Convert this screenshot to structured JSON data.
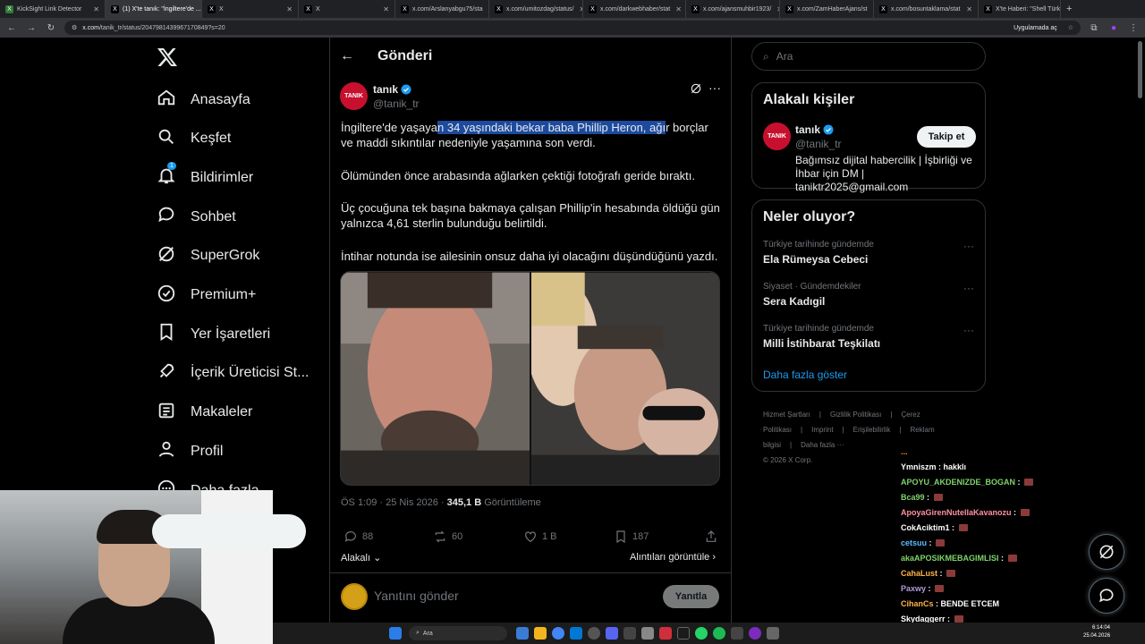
{
  "browser": {
    "tabs": [
      {
        "title": "KickSight Link Detector",
        "active": false,
        "color": "#2e7d32"
      },
      {
        "title": "(1) X'te tanık: \"İngiltere'de ...",
        "active": true,
        "color": "#000000"
      },
      {
        "title": "X",
        "active": false,
        "color": "#000000"
      },
      {
        "title": "X",
        "active": false,
        "color": "#000000"
      },
      {
        "title": "x.com/Arslanyabgu75/sta",
        "active": false,
        "color": "#000000"
      },
      {
        "title": "x.com/umitozdag/status/",
        "active": false,
        "color": "#000000"
      },
      {
        "title": "x.com/darkwebhaber/stat",
        "active": false,
        "color": "#000000"
      },
      {
        "title": "x.com/ajansmuhbir1923/",
        "active": false,
        "color": "#000000"
      },
      {
        "title": "x.com/ZamHaberAjans/st",
        "active": false,
        "color": "#000000"
      },
      {
        "title": "x.com/bosuntaklama/stat",
        "active": false,
        "color": "#000000"
      },
      {
        "title": "X'te Haberi: \"Shell Türkiye",
        "active": false,
        "color": "#000000"
      }
    ],
    "url_host": "x.com",
    "url_path": "/tanik_tr/status/2047981439967170849?s=20",
    "install_label": "Uygulamada aç"
  },
  "sidebar": {
    "items": [
      {
        "label": "Anasayfa",
        "icon": "home-icon"
      },
      {
        "label": "Keşfet",
        "icon": "search-icon"
      },
      {
        "label": "Bildirimler",
        "icon": "bell-icon",
        "badge": "1"
      },
      {
        "label": "Sohbet",
        "icon": "chat-icon"
      },
      {
        "label": "SuperGrok",
        "icon": "grok-icon"
      },
      {
        "label": "Premium+",
        "icon": "verified-icon"
      },
      {
        "label": "Yer İşaretleri",
        "icon": "bookmark-icon"
      },
      {
        "label": "İçerik Üreticisi St...",
        "icon": "rocket-icon"
      },
      {
        "label": "Makaleler",
        "icon": "article-icon"
      },
      {
        "label": "Profil",
        "icon": "person-icon"
      },
      {
        "label": "Daha fazla",
        "icon": "more-icon"
      }
    ]
  },
  "post": {
    "header_title": "Gönderi",
    "author_name": "tanık",
    "author_handle": "@tanik_tr",
    "avatar_text": "TANIK",
    "para1_pre": "İngiltere'de yaşaya",
    "para1_hl": "n 34 yaşındaki bekar baba Phillip Heron, ağı",
    "para1_post": "r borçlar ve maddi sıkıntılar nedeniyle yaşamına son verdi.",
    "para2": "Ölümünden önce arabasında ağlarken çektiği fotoğrafı geride bıraktı.",
    "para3": "Üç çocuğuna tek başına bakmaya çalışan Phillip'in hesabında öldüğü gün yalnızca 4,61 sterlin bulunduğu belirtildi.",
    "para4": "İntihar notunda ise ailesinin onsuz daha iyi olacağını düşündüğünü yazdı.",
    "time": "ÖS 1:09 · 25 Nis 2026 · ",
    "views": "345,1 B",
    "views_label": " Görüntüleme",
    "replies": "88",
    "reposts": "60",
    "likes": "1 B",
    "bookmarks": "187",
    "relevant_label": "Alakalı",
    "quotes_label": "Alıntıları görüntüle",
    "reply_placeholder": "Yanıtını gönder",
    "reply_button": "Yanıtla"
  },
  "right": {
    "search_placeholder": "Ara",
    "related_title": "Alakalı kişiler",
    "related_person": {
      "name": "tanık",
      "handle": "@tanik_tr",
      "bio": "Bağımsız dijital habercilik | İşbirliği ve İhbar için DM | taniktr2025@gmail.com",
      "follow_label": "Takip et",
      "avatar_text": "TANIK"
    },
    "trends_title": "Neler oluyor?",
    "trends": [
      {
        "category": "Türkiye tarihinde gündemde",
        "name": "Ela Rümeysa Cebeci"
      },
      {
        "category": "Siyaset · Gündemdekiler",
        "name": "Sera Kadıgil"
      },
      {
        "category": "Türkiye tarihinde gündemde",
        "name": "Milli İstihbarat Teşkilatı"
      }
    ],
    "show_more": "Daha fazla göster",
    "footer_links": [
      "Hizmet Şartları",
      "|",
      "Gizlilik Politikası",
      "|",
      "Çerez Politikası",
      "|",
      "Imprint",
      "|",
      "Erişilebilirlik",
      "|",
      "Reklam bilgisi",
      "|",
      "Daha fazla ···"
    ],
    "copyright": "© 2026 X Corp."
  },
  "chat": [
    {
      "user": "Ymniszm",
      "text": "hakklı",
      "emote": false
    },
    {
      "user": "APOYU_AKDENIZDE_BOGAN",
      "text": "",
      "emote": true
    },
    {
      "user": "Bca99",
      "text": "",
      "emote": true
    },
    {
      "user": "ApoyaGirenNutellaKavanozu",
      "text": "",
      "emote": true
    },
    {
      "user": "CokAciktim1",
      "text": "",
      "emote": true
    },
    {
      "user": "cetsuu",
      "text": "",
      "emote": true
    },
    {
      "user": "akaAPOSIKMEBAGIMLISI",
      "text": "",
      "emote": true
    },
    {
      "user": "CahaLust",
      "text": "",
      "emote": true
    },
    {
      "user": "Paxwy",
      "text": "",
      "emote": true
    },
    {
      "user": "CihanCs",
      "text": "BENDE ETCEM",
      "emote": false
    },
    {
      "user": "Skydaggerr",
      "text": "",
      "emote": true
    }
  ],
  "taskbar": {
    "search_label": "Ara",
    "time": "6:14:04",
    "date": "25.04.2026"
  },
  "colors": {
    "accent": "#1d9bf0",
    "verified": "#1d9bf0",
    "highlight": "#1d4a9e",
    "brand_red": "#c8102e"
  }
}
